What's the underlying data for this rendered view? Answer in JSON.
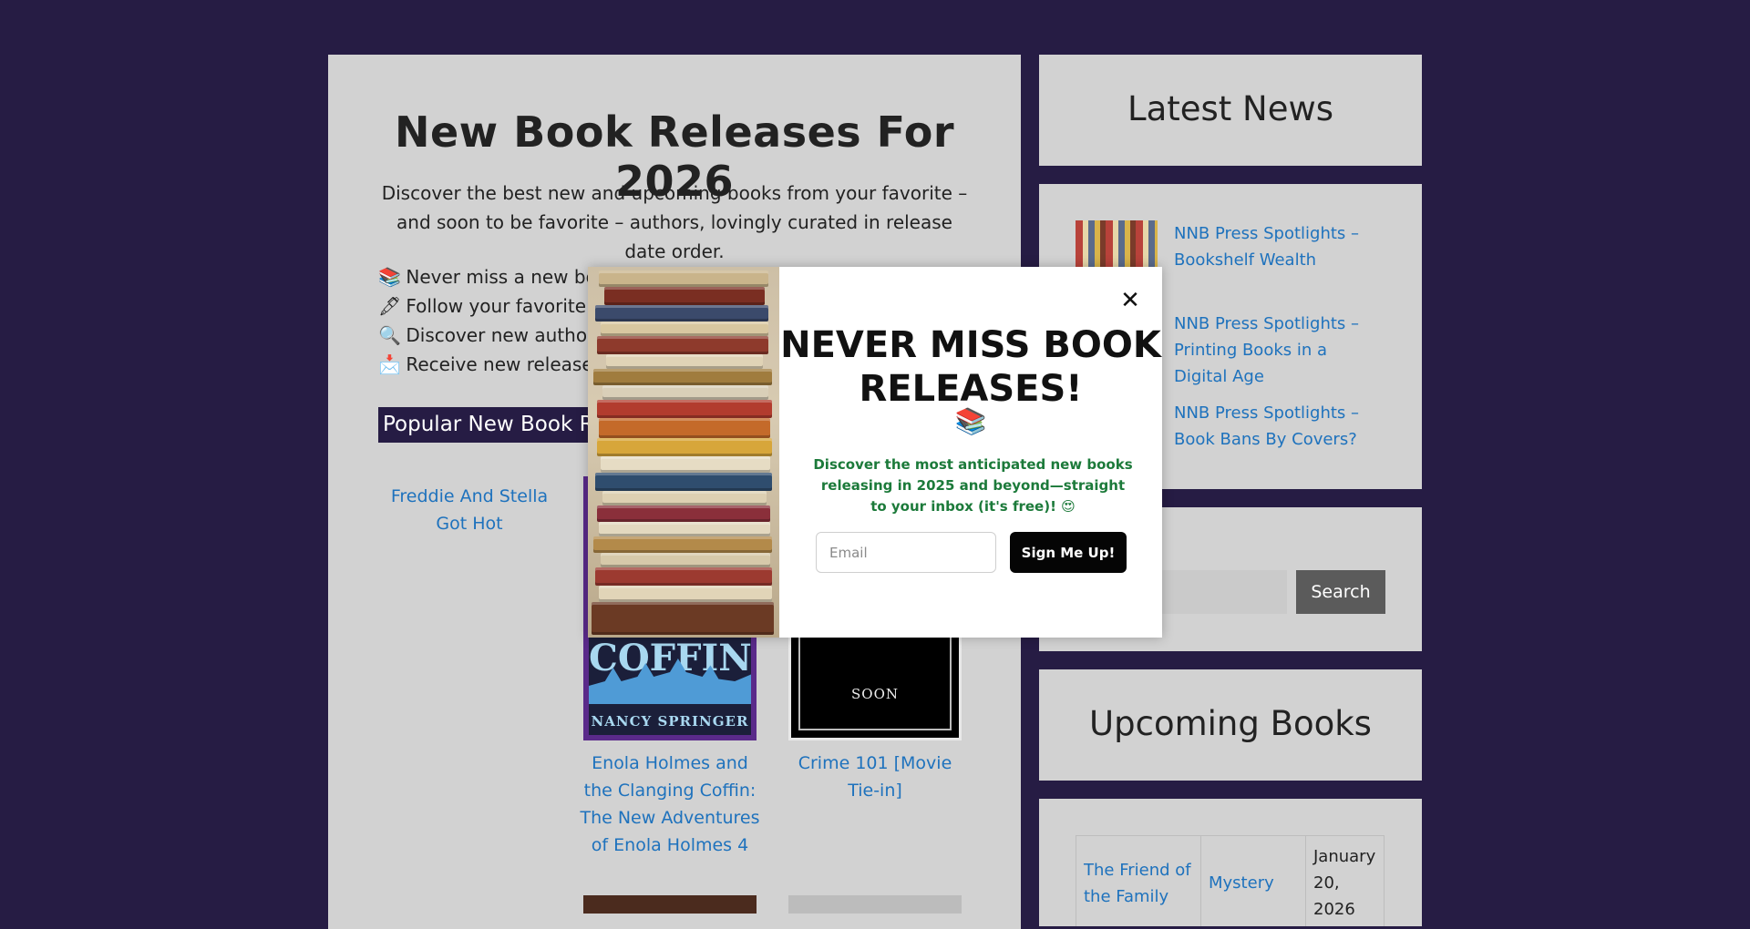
{
  "main": {
    "title": "New Book Releases For 2026",
    "intro": "Discover the best new and upcoming books from your favorite – and soon to be favorite – authors, lovingly curated in release date order.",
    "features": [
      {
        "icon": "📚",
        "icon_name": "books-icon",
        "text": "Never miss a new book"
      },
      {
        "icon": "🖋",
        "icon_name": "pen-icon",
        "text": "Follow your favorite aut"
      },
      {
        "icon": "🔍",
        "icon_name": "magnifier-icon",
        "text": "Discover new authors"
      },
      {
        "icon": "📩",
        "icon_name": "envelope-icon",
        "text": "Receive new releases e"
      }
    ],
    "section_heading": "Popular New Book Rel",
    "books": [
      {
        "title": "Freddie And Stella Got Hot"
      },
      {
        "title": "Enola Holmes and the Clanging Coffin: The New Adventures of Enola Holmes 4",
        "cover_text": "COFFIN",
        "cover_author": "NANCY SPRINGER"
      },
      {
        "title": "Crime 101 [Movie Tie-in]",
        "cover_text": "SOON"
      }
    ]
  },
  "sidebar": {
    "latest_news": {
      "title": "Latest News",
      "items": [
        {
          "label": "NNB Press Spotlights – Bookshelf Wealth"
        },
        {
          "label": "NNB Press Spotlights – Printing Books in a Digital Age"
        },
        {
          "label": "NNB Press Spotlights – Book Bans By Covers?"
        }
      ]
    },
    "search": {
      "button_label": "Search",
      "placeholder": ""
    },
    "upcoming": {
      "title": "Upcoming Books",
      "rows": [
        {
          "title": "The Friend of the Family",
          "genre": "Mystery",
          "date": "January 20, 2026"
        }
      ]
    }
  },
  "modal": {
    "close_glyph": "✕",
    "heading": "NEVER MISS BOOK RELEASES!",
    "heading_emoji": "📚",
    "subtext": "Discover the most anticipated new books releasing in 2025 and beyond—straight to your inbox (it's free)! 😍",
    "email_placeholder": "Email",
    "submit_label": "Sign Me Up!"
  },
  "colors": {
    "page_background": "#261c44",
    "panel": "#d2d2d2",
    "link": "#1e72bd",
    "modal_subtext": "#1c7a3a",
    "button_dark": "#050505"
  }
}
